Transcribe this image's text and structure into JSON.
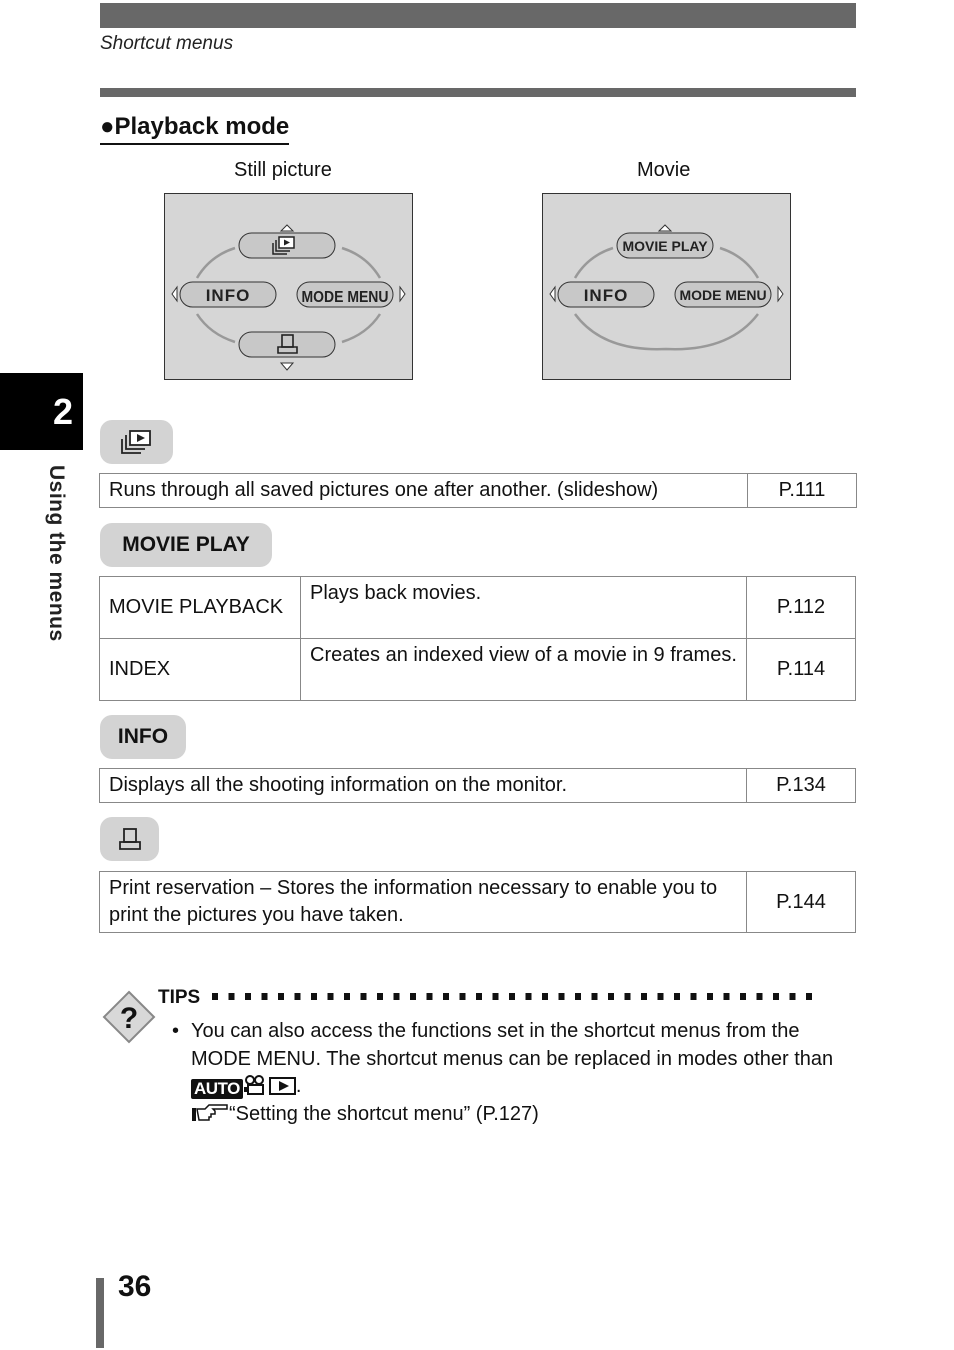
{
  "header": {
    "section_label": "Shortcut menus"
  },
  "section": {
    "title": "●Playback mode"
  },
  "side_tab": {
    "chapter_number": "2",
    "chapter_label": "Using the menus"
  },
  "screens": {
    "still": {
      "caption": "Still picture",
      "top_button_icon": "slideshow-icon",
      "left_button": "INFO",
      "right_button": "MODE MENU",
      "bottom_button_icon": "print-icon"
    },
    "movie": {
      "caption": "Movie",
      "top_button": "MOVIE PLAY",
      "left_button": "INFO",
      "right_button": "MODE MENU"
    }
  },
  "blocks": [
    {
      "label_icon": "slideshow-icon",
      "rows": [
        {
          "description": "Runs through all saved pictures one after another. (slideshow)",
          "page": "P.111"
        }
      ]
    },
    {
      "label": "MOVIE PLAY",
      "rows": [
        {
          "name": "MOVIE PLAYBACK",
          "description": "Plays back movies.",
          "page": "P.112"
        },
        {
          "name": "INDEX",
          "description": "Creates an indexed view of a movie in 9 frames.",
          "page": "P.114"
        }
      ]
    },
    {
      "label": "INFO",
      "rows": [
        {
          "description": "Displays all the shooting information on the monitor.",
          "page": "P.134"
        }
      ]
    },
    {
      "label_icon": "print-icon",
      "rows": [
        {
          "description": "Print reservation – Stores the information necessary to enable you to print the pictures you have taken.",
          "page": "P.144"
        }
      ]
    }
  ],
  "tips": {
    "heading": "TIPS",
    "bullet": "•",
    "text": "You can also access the functions set in the shortcut menus from the MODE MENU. The shortcut menus can be replaced in modes other than",
    "mode_icons": [
      "AUTO",
      "movie-camera-icon",
      "playback-icon"
    ],
    "auto_label": "AUTO",
    "after_icons": ".",
    "reference": "“Setting the shortcut menu” (P.127)"
  },
  "footer": {
    "page_number": "36"
  }
}
